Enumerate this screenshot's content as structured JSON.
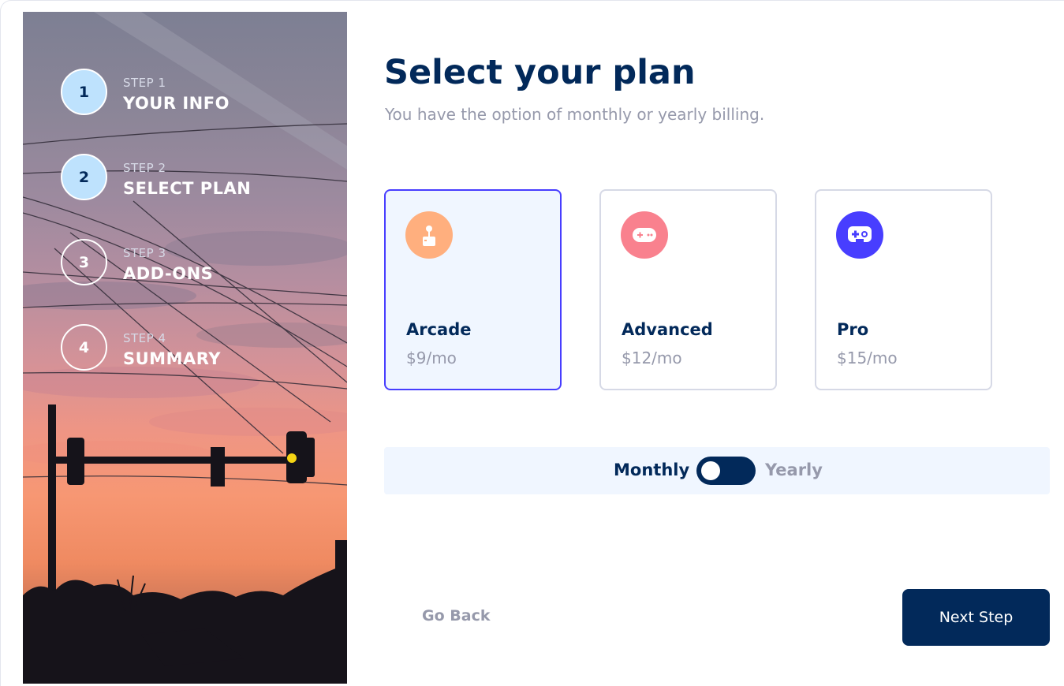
{
  "sidebar": {
    "steps": [
      {
        "number": "1",
        "label": "STEP 1",
        "title": "YOUR INFO",
        "active": true
      },
      {
        "number": "2",
        "label": "STEP 2",
        "title": "SELECT PLAN",
        "active": true
      },
      {
        "number": "3",
        "label": "STEP 3",
        "title": "ADD-ONS",
        "active": false
      },
      {
        "number": "4",
        "label": "STEP 4",
        "title": "SUMMARY",
        "active": false
      }
    ]
  },
  "main": {
    "title": "Select your plan",
    "subtitle": "You have the option of monthly or yearly billing.",
    "plans": [
      {
        "name": "Arcade",
        "price": "$9/mo",
        "icon": "arcade-joystick-icon",
        "color": "#ffaf7e",
        "selected": true
      },
      {
        "name": "Advanced",
        "price": "$12/mo",
        "icon": "gamepad-icon",
        "color": "#f9818e",
        "selected": false
      },
      {
        "name": "Pro",
        "price": "$15/mo",
        "icon": "controller-icon",
        "color": "#483eff",
        "selected": false
      }
    ],
    "billing": {
      "monthly_label": "Monthly",
      "yearly_label": "Yearly",
      "selected": "Monthly"
    },
    "buttons": {
      "back_label": "Go Back",
      "next_label": "Next Step"
    }
  },
  "colors": {
    "primary_navy": "#02295a",
    "accent_purple": "#473dff",
    "active_step": "#bee2fd",
    "muted_text": "#9699ab",
    "light_bg": "#f0f6ff",
    "border": "#d6d9e6"
  }
}
